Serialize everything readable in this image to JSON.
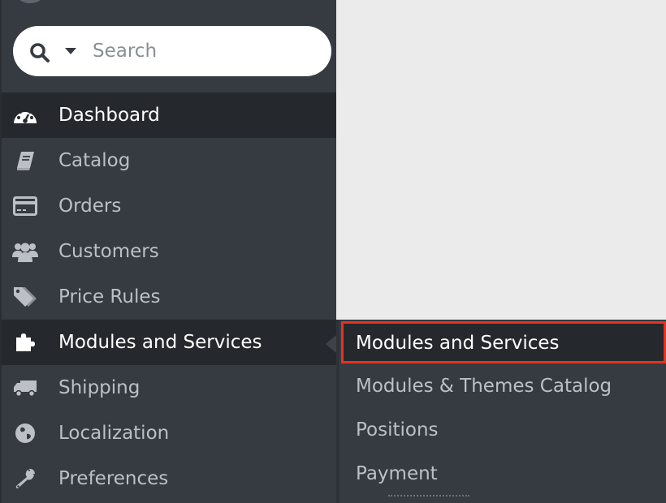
{
  "search": {
    "placeholder": "Search"
  },
  "sidebar": {
    "items": [
      {
        "label": "Dashboard",
        "icon": "dashboard-gauge-icon",
        "active": true
      },
      {
        "label": "Catalog",
        "icon": "book-icon"
      },
      {
        "label": "Orders",
        "icon": "credit-card-icon"
      },
      {
        "label": "Customers",
        "icon": "users-icon"
      },
      {
        "label": "Price Rules",
        "icon": "tags-icon"
      },
      {
        "label": "Modules and Services",
        "icon": "puzzle-icon",
        "active": true
      },
      {
        "label": "Shipping",
        "icon": "truck-icon"
      },
      {
        "label": "Localization",
        "icon": "globe-icon"
      },
      {
        "label": "Preferences",
        "icon": "wrench-icon"
      }
    ]
  },
  "submenu": {
    "items": [
      {
        "label": "Modules and Services",
        "selected": true
      },
      {
        "label": "Modules & Themes Catalog"
      },
      {
        "label": "Positions"
      },
      {
        "label": "Payment"
      }
    ]
  },
  "colors": {
    "sidebar_bg": "#363a41",
    "active_bg": "#25282c",
    "highlight_border": "#e8311f",
    "content_bg": "#ebebeb"
  }
}
